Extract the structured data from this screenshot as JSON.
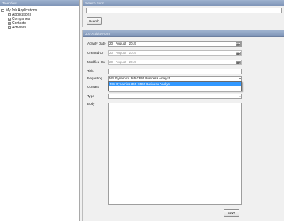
{
  "tree": {
    "header": "Tree View",
    "root_label": "My Job Applications",
    "nodes": [
      {
        "label": "Applications"
      },
      {
        "label": "Companies"
      },
      {
        "label": "Contacts"
      },
      {
        "label": "Activities"
      }
    ]
  },
  "search": {
    "header": "Search Form",
    "query": "",
    "button_label": "Search"
  },
  "form": {
    "header": "Job Activity Form",
    "fields": {
      "activity_date": {
        "label": "Activity Date",
        "day": "20",
        "month": "August",
        "year": "2019"
      },
      "created_on": {
        "label": "Created On",
        "day": "20",
        "month": "August",
        "year": "2019"
      },
      "modified_on": {
        "label": "Modified On",
        "day": "20",
        "month": "August",
        "year": "2019"
      },
      "title": {
        "label": "Title",
        "value": ""
      },
      "regarding": {
        "label": "Regarding",
        "value": "MS Dynamics 365 CRM Business Analyst"
      },
      "contact": {
        "label": "Contact",
        "value": ""
      },
      "type": {
        "label": "Type",
        "value": ""
      },
      "body": {
        "label": "Body",
        "value": ""
      }
    },
    "regarding_options": [
      {
        "label": "MS Dynamics 365 CRM Business Analyst",
        "selected": true
      }
    ],
    "save_label": "Save"
  },
  "icons": {
    "calendar": "calendar-icon",
    "dropdown": "chevron-down-icon",
    "tree_expand": "plus-icon",
    "tree_collapse": "minus-icon"
  }
}
